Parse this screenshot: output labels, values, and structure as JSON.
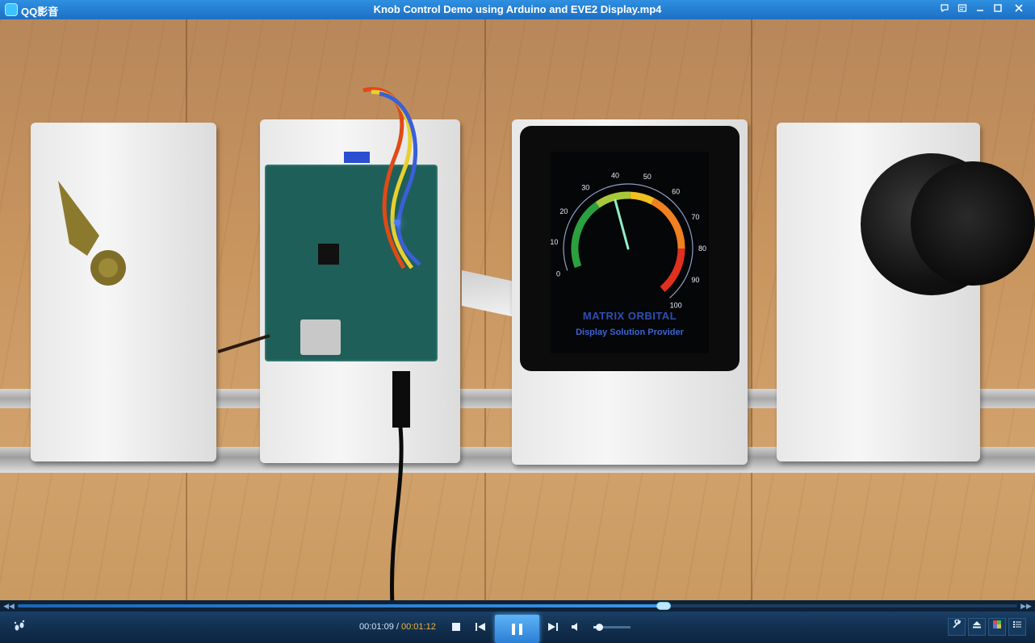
{
  "app": {
    "name": "QQ影音",
    "window_title": "Knob Control Demo using Arduino and EVE2 Display.mp4"
  },
  "titlebar_icons": [
    "chat-bubble-icon",
    "skin-icon",
    "minimize-icon",
    "maximize-icon",
    "close-icon"
  ],
  "video": {
    "gauge": {
      "ticks": [
        "0",
        "10",
        "20",
        "30",
        "40",
        "50",
        "60",
        "70",
        "80",
        "90",
        "100"
      ],
      "needle_value": 38
    },
    "brand": {
      "logo_text": "MATRIX ORBITAL",
      "tagline": "Display Solution Provider"
    }
  },
  "playback": {
    "current_time": "00:01:09",
    "separator": "/",
    "total_time": "00:01:12",
    "progress_fraction": 0.646,
    "volume_fraction": 0.15
  },
  "colors": {
    "title_bar": "#1c6fc4",
    "accent": "#3c95e8",
    "total_time": "#f2b33a"
  }
}
